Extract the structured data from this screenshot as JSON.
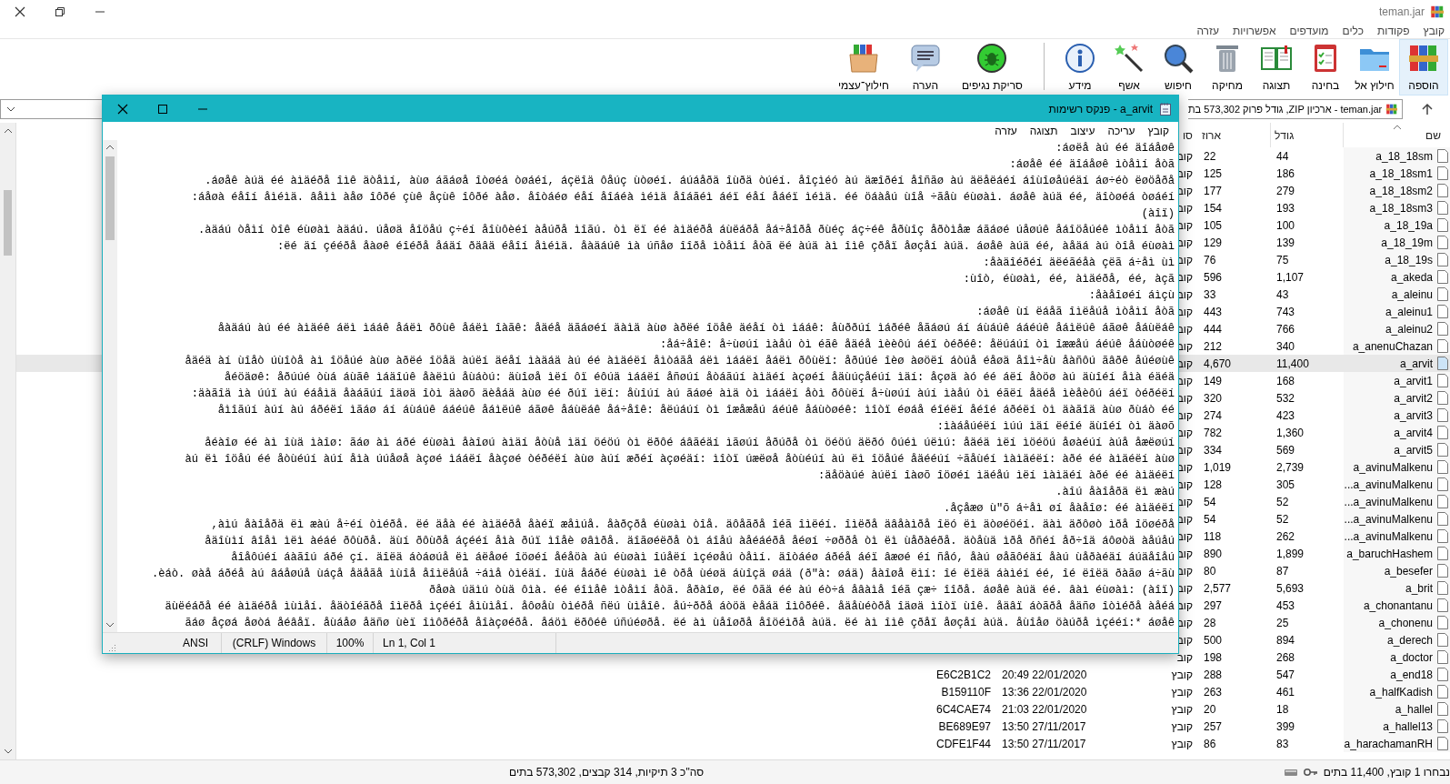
{
  "window": {
    "title": "teman.jar"
  },
  "menu": [
    "קובץ",
    "פקודות",
    "כלים",
    "מועדפים",
    "אפשרויות",
    "עזרה"
  ],
  "toolbar": {
    "groups": [
      [
        {
          "label": "הוספה",
          "kind": "add",
          "selected": true
        },
        {
          "label": "חילוץ אל",
          "kind": "extract",
          "selected": false
        },
        {
          "label": "בחינה",
          "kind": "test",
          "selected": false
        },
        {
          "label": "תצוגה",
          "kind": "view",
          "selected": false
        },
        {
          "label": "מחיקה",
          "kind": "delete",
          "selected": false
        },
        {
          "label": "חיפוש",
          "kind": "find",
          "selected": false
        },
        {
          "label": "אשף",
          "kind": "wizard",
          "selected": false
        },
        {
          "label": "מידע",
          "kind": "info",
          "selected": false
        }
      ],
      [
        {
          "label": "סריקת נגיפים",
          "kind": "virus",
          "selected": false
        },
        {
          "label": "הערה",
          "kind": "comment",
          "selected": false
        },
        {
          "label": "חילוץ־עצמי",
          "kind": "sfx",
          "selected": false
        }
      ]
    ]
  },
  "address": {
    "text": "teman.jar - ארכיון ZIP, גודל פרוק 573,302 בת"
  },
  "file_list": {
    "columns": [
      {
        "label": "שם",
        "sorted": true
      },
      {
        "label": "גודל",
        "sorted": false
      },
      {
        "label": "ארוז",
        "sorted": false
      },
      {
        "label": "סו",
        "sorted": false
      }
    ],
    "rows": [
      {
        "name": "a_18_18sm",
        "size": "44",
        "packed": "22",
        "type": "קוב",
        "selected": false
      },
      {
        "name": "a_18_18sm1",
        "size": "186",
        "packed": "125",
        "type": "קוב",
        "selected": false
      },
      {
        "name": "a_18_18sm2",
        "size": "279",
        "packed": "177",
        "type": "קוב",
        "selected": false
      },
      {
        "name": "a_18_18sm3",
        "size": "193",
        "packed": "154",
        "type": "קוב",
        "selected": false
      },
      {
        "name": "a_18_19a",
        "size": "100",
        "packed": "105",
        "type": "קוב",
        "selected": false
      },
      {
        "name": "a_18_19m",
        "size": "139",
        "packed": "129",
        "type": "קוב",
        "selected": false
      },
      {
        "name": "a_18_19s",
        "size": "75",
        "packed": "76",
        "type": "קוב",
        "selected": false
      },
      {
        "name": "a_akeda",
        "size": "1,107",
        "packed": "596",
        "type": "קוב",
        "selected": false
      },
      {
        "name": "a_aleinu",
        "size": "43",
        "packed": "33",
        "type": "קוב",
        "selected": false
      },
      {
        "name": "a_aleinu1",
        "size": "743",
        "packed": "443",
        "type": "קוב",
        "selected": false
      },
      {
        "name": "a_aleinu2",
        "size": "766",
        "packed": "444",
        "type": "קוב",
        "selected": false
      },
      {
        "name": "a_anenuChazan",
        "size": "340",
        "packed": "212",
        "type": "קוב",
        "selected": false
      },
      {
        "name": "a_arvit",
        "size": "11,400",
        "packed": "4,670",
        "type": "קוב",
        "selected": true
      },
      {
        "name": "a_arvit1",
        "size": "168",
        "packed": "149",
        "type": "קוב",
        "selected": false
      },
      {
        "name": "a_arvit2",
        "size": "532",
        "packed": "320",
        "type": "קוב",
        "selected": false
      },
      {
        "name": "a_arvit3",
        "size": "423",
        "packed": "274",
        "type": "קוב",
        "selected": false
      },
      {
        "name": "a_arvit4",
        "size": "1,360",
        "packed": "782",
        "type": "קוב",
        "selected": false
      },
      {
        "name": "a_arvit5",
        "size": "569",
        "packed": "334",
        "type": "קוב",
        "selected": false
      },
      {
        "name": "a_avinuMalkenu",
        "size": "2,739",
        "packed": "1,019",
        "type": "קוב",
        "selected": false
      },
      {
        "name": "...a_avinuMalkenu",
        "size": "305",
        "packed": "128",
        "type": "קוב",
        "selected": false
      },
      {
        "name": "...a_avinuMalkenu",
        "size": "52",
        "packed": "54",
        "type": "קוב",
        "selected": false
      },
      {
        "name": "...a_avinuMalkenu",
        "size": "52",
        "packed": "54",
        "type": "קוב",
        "selected": false
      },
      {
        "name": "...a_avinuMalkenu",
        "size": "262",
        "packed": "118",
        "type": "קוב",
        "selected": false
      },
      {
        "name": "a_baruchHashem",
        "size": "1,899",
        "packed": "890",
        "type": "קוב",
        "selected": false
      },
      {
        "name": "a_besefer",
        "size": "87",
        "packed": "80",
        "type": "קוב",
        "selected": false
      },
      {
        "name": "a_brit",
        "size": "5,693",
        "packed": "2,577",
        "type": "קוב",
        "selected": false
      },
      {
        "name": "a_chonantanu",
        "size": "453",
        "packed": "297",
        "type": "קוב",
        "selected": false
      },
      {
        "name": "a_chonenu",
        "size": "25",
        "packed": "28",
        "type": "קוב",
        "selected": false
      },
      {
        "name": "a_derech",
        "size": "894",
        "packed": "500",
        "type": "קוב",
        "selected": false
      },
      {
        "name": "a_doctor",
        "size": "268",
        "packed": "198",
        "type": "קוב",
        "selected": false
      },
      {
        "name": "a_end18",
        "size": "547",
        "packed": "288",
        "type": "קובץ",
        "modified": "20:49 22/01/2020",
        "crc": "E6C2B1C2",
        "selected": false
      },
      {
        "name": "a_halfKadish",
        "size": "461",
        "packed": "263",
        "type": "קובץ",
        "modified": "13:36 22/01/2020",
        "crc": "B159110F",
        "selected": false
      },
      {
        "name": "a_hallel",
        "size": "18",
        "packed": "20",
        "type": "קובץ",
        "modified": "21:03 22/01/2020",
        "crc": "6C4CAE74",
        "selected": false
      },
      {
        "name": "a_hallel13",
        "size": "399",
        "packed": "257",
        "type": "קובץ",
        "modified": "13:50 27/11/2017",
        "crc": "BE689E97",
        "selected": false
      },
      {
        "name": "a_harachamanRH",
        "size": "83",
        "packed": "86",
        "type": "קובץ",
        "modified": "13:50 27/11/2017",
        "crc": "CDFE1F44",
        "selected": false
      }
    ]
  },
  "status_bar": {
    "totals": "סה\"כ 3 תיקיות, 314 קבצים, 573,302 בתים",
    "selection": "נבחרו 1 קובץ, 11,400 בתים"
  },
  "notepad": {
    "title": "a_arvit - פנקס רשימות",
    "menu": [
      "קובץ",
      "עריכה",
      "עיצוב",
      "תצוגה",
      "עזרה"
    ],
    "lines": [
      ":áøëå àú éé äîáåøê",
      ":áøåê éé äîáåøê ìòåìí åòã",
      ".áøåê àúä éé àìäéðå îìê äòåìí, àùø áãáøå îòøéá òøáéí, áçëîä ôåúç ùòøéí. áúáåðä îùðä òúéí. åîçìéó àú äæîðéí åîñãø àú äëåëáéí áîùîøåúéäí áø÷éò ëøöåðå",
      ":áåøà éåîí åìéìä. âåìì àåø îôðé çùê åçùê îôðé àåø. åîòáéø éåí åîáéà ìéìä åîáãéì áéï éåí åáéï ìéìä. éé öáàåú ùîå ÷ãåù éùøàì. áøåê àúä éé, äîòøéá òøáéí",
      "(àîï)",
      ".àäáú òåìí òîê éùøàì àäáú. úåøä åîöåú ç÷éí åîùôèéí àåúðå ìîãú. òì ëï éé àìäéðå áùëáðå åá÷åîðå ðùéç áç÷éê åðùîç åðòìåæ áãáøé úåøúê åáîöåúéê ìòåìí åòã",
      ":ëé äí çééðå åàøê éîéðå åáäí ðäâä éåîí åìéìä. åàäáúê ìà úñåø îîðå ìòåìí åòã ëé àúä àì îìê çðåï åøçåí àúä. áøåê àúä éé, àåäá àú òîå éùøàì",
      ":åàäîéðéí äëéãéåà çëã á÷åì ùì",
      ":ùîò, éùøàì, éé, àìäéðå, éé, àçã",
      ":åàåîøéí áìçù",
      ":áøåê ùí ëáåã îìëåúå ìòåìí åòã",
      "åàäáú àú éé àìäéê áëì ìááê åáëì ðôùê åáëì îàãê: åäéå äãáøéí äàìä àùø àðëé îöåê äéåí òì ìááê: åùððúí ìáðéê åãáøú áí áùáúê ááéúê åáìëúê áãøê åáùëáê",
      ":åá÷åîê: å÷ùøúí ìàåú òì éãê åäéå ìèèôú áéï òéðéê: åëúáúí òì îææåú áéúê åáùòøéê",
      "åäéä àí ùîåò úùîòå àì îöåúé àùø àðëé îöåä àúëí äéåí ìàäáä àú éé àìäéëí åìòáãå áëì ìááëí åáëì ðôùëí: åðúúé îèø àøöëí áòúå éåøä åîì÷åù åàñôú ãâðê åúéøùê",
      "åéöäøê: åðúúé òùá áùãê ìáäîúê åàëìú åùáòú: äùîøå ìëí ôï éôúä ìááëí åñøúí åòáãúí àìäéí àçøéí åäùúçåéúí ìäí: åçøä àó éé áëí åòöø àú äùîéí åìà éäéä",
      ":äàãîä ìà úúï àú éáåìä åàáãúí îäøä îòì äàøõ äèåáä àùø éé ðúï ìëí: åùîúí àú ãáøé àìä òì ìááëí åòì ðôùëí å÷ùøúí àúí ìàåú òì éãëí åäéå ìèåèôú áéï òéðéëí",
      "åìîãúí àúí àú áðéëí ìãáø áí áùáúê ááéúê åáìëúê áãøê åáùëáê åá÷åîê: åëúáúí òì îæåæåú áéúê åáùòøéê: ìîòï éøáå éîéëí åéîé áðéëí òì äàãîä àùø ðùáò éé",
      ":ìàáåúéëí ìúú ìäí ëéîé äùîéí òì äàøõ",
      "åéàîø éé àì îùä ìàîø: ãáø àì áðé éùøàì åàîøú àìäí åòùå ìäí öéöú òì ëðôé áâãéäí ìãøúí åðúðå òì öéöú äëðó ôúéì úëìú: åäéä ìëí ìöéöú åøàéúí àúå åæëøúí",
      "àú ëì îöåú éé åòùéúí àúí åìà úúåøå àçøé ìááëí åàçøé òéðéëí àùø àúí æðéí àçøéäí: ìîòï úæëøå åòùéúí àú ëì îöåúé åäééúí ÷ãåùéí ìàìäéëí: àðé éé àìäéëí àùø",
      ":äåöàúé àúëí îàøõ îöøéí ìäéåú ìëí ìàìäéí àðé éé àìäéëí",
      ".àîú åàîåðä ëì æàú",
      ".åçåæø ù\"õ á÷åì øí åàåîø: éé àìäéëí",
      ",àìú åàîåðä ëì æàú å÷éí òìéðå. ëé äåà éé àìäéðå åàéï æåìúå. åàðçðå éùøàì òîå. äôåãðå îéã îìëéí. îìëðå äâåàìðå îëó ëì äòøéöéí. äàì äðôøò ìðå îöøéðå",
      "åäîùìí âîåì ìëì àéáé ðôùðå. äùí ðôùðå áçééí åìà ðúï ìîåè øâìðå. äîãøéëðå òì áîåú àåéáéðå åéøí ÷øððå òì ëì ùåðàéðå. äòåùä ìðå ðñéí åð÷îä áôøòä àåúåú",
      "åîåôúéí áàãîú áðé çí. äîëä áòáøúå ëì áëåøé îöøéí åéåöà àú éùøàì îúåëí ìçéøåú òåìí. äîòáéø áðéå áéï âæøé éí ñåó, åàú øåãôéäí åàú ùåðàéäí áúäåîåú",
      ".èáò. øàå áðéå àú âáåøúå ùáçå åäåãå ìùîå åîìëåúå ÷áìå òìéäí. îùä åáðé éùøàì ìê òðå ùéøä áùîçä øáä (ð\"à: øáä) åàîøå ëìí: îé ëîëä áàìéí éé, îé ëîëä ðàãø á÷ãù",
      "ðåøà úäìú òùä ôìà. éé éîìåê ìòåìí åòã. åðàîø, ëé ôãä éé àú éò÷á åâàìå îéã çæ÷ îîðå. áøåê àúä éé. âàì éùøàì: (àîï)",
      "äùëéáðå éé àìäéðå ìùìåí. åäòîéãðå îìëðå ìçééí åìùìåí. åôøåù òìéðå ñëú ùìåîê. åú÷ððå áòöä èåáä îìôðéê. åäåùéòðå îäøä ìîòï ùîê. åäâï áòãðå åäñø îòìéðå àåéá",
      "ãáø åçøá åøòá åéâåï. åùáåø åäñø ùèï îìôðéðå åîàçøéðå. åáöì ëðôéê úñúéøðå. ëé àì ùåîøðå åîöéìðå àúä. ëé àì îìê çðåï åøçåí àúä. åùîåø öàúðå ìçééí:* áøåê"
    ],
    "status": [
      "Ln 1, Col 1",
      "100%",
      "(CRLF) Windows",
      "ANSI"
    ]
  }
}
